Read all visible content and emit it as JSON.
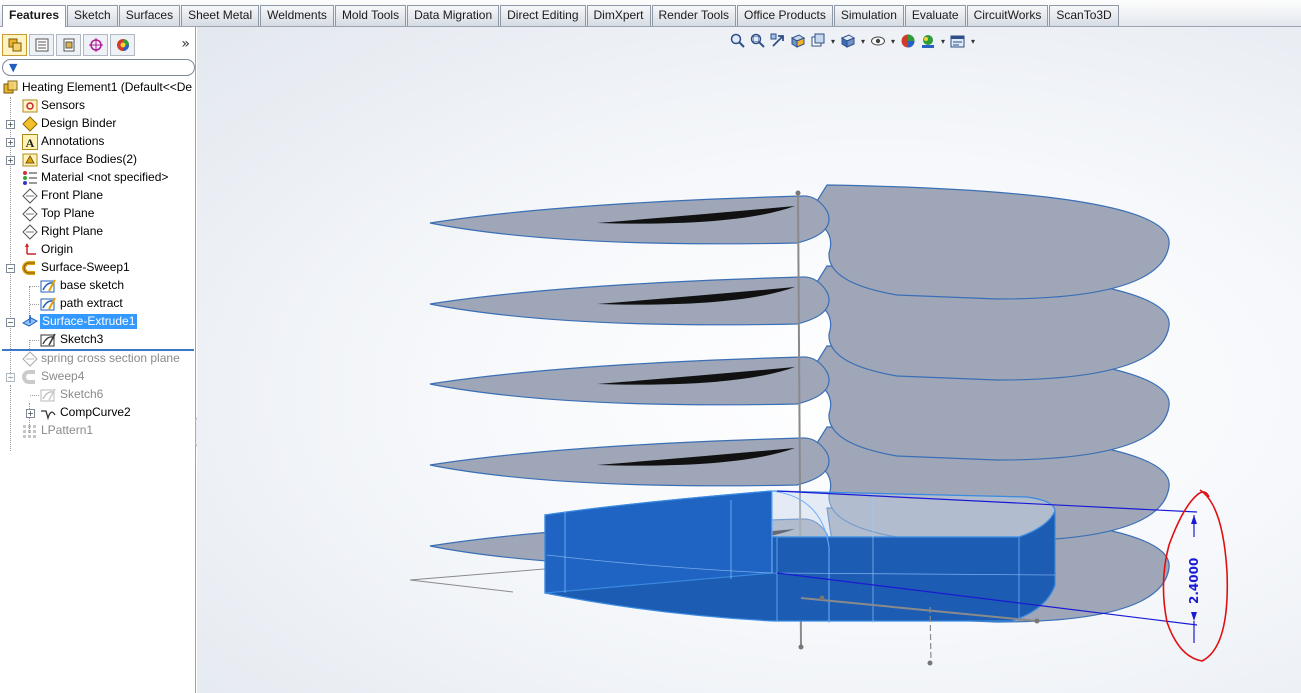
{
  "command_manager": {
    "tabs": [
      "Features",
      "Sketch",
      "Surfaces",
      "Sheet Metal",
      "Weldments",
      "Mold Tools",
      "Data Migration",
      "Direct Editing",
      "DimXpert",
      "Render Tools",
      "Office Products",
      "Simulation",
      "Evaluate",
      "CircuitWorks",
      "ScanTo3D"
    ],
    "active_tab": "Features"
  },
  "feature_manager": {
    "panel_tabs": [
      "featuremanager-tree-icon",
      "propertymanager-icon",
      "configurationmanager-icon",
      "dimxpert-manager-icon",
      "display-manager-icon"
    ],
    "more_label": "»",
    "tree": {
      "part": "Heating Element1  (Default<<De",
      "sensors": "Sensors",
      "design_binder": "Design Binder",
      "annotations": "Annotations",
      "surface_bodies": "Surface Bodies(2)",
      "material": "Material <not specified>",
      "front_plane": "Front Plane",
      "top_plane": "Top Plane",
      "right_plane": "Right Plane",
      "origin": "Origin",
      "surface_sweep": "Surface-Sweep1",
      "base_sketch": "base sketch",
      "path_extract": "path extract",
      "surface_extrude": "Surface-Extrude1",
      "sketch3": "Sketch3",
      "spring_plane": "spring cross section plane",
      "sweep4": "Sweep4",
      "sketch6": "Sketch6",
      "compcurve": "CompCurve2",
      "lpattern": "LPattern1"
    }
  },
  "heads_up_toolbar": [
    "zoom-to-fit-icon",
    "zoom-to-area-icon",
    "previous-view-icon",
    "section-view-icon",
    "view-orientation-icon",
    "display-style-icon",
    "hide-show-items-icon",
    "edit-appearance-icon",
    "apply-scene-icon",
    "view-settings-icon"
  ],
  "graphics": {
    "dimension_value": "2.4000",
    "colors": {
      "surface_fill": "#9ea6b8",
      "surface_edge": "#3a6fb5",
      "extrude_blue": "#1c5cb3",
      "dimension_blue": "#1a1ad4",
      "annotation_red": "#e01010"
    }
  }
}
